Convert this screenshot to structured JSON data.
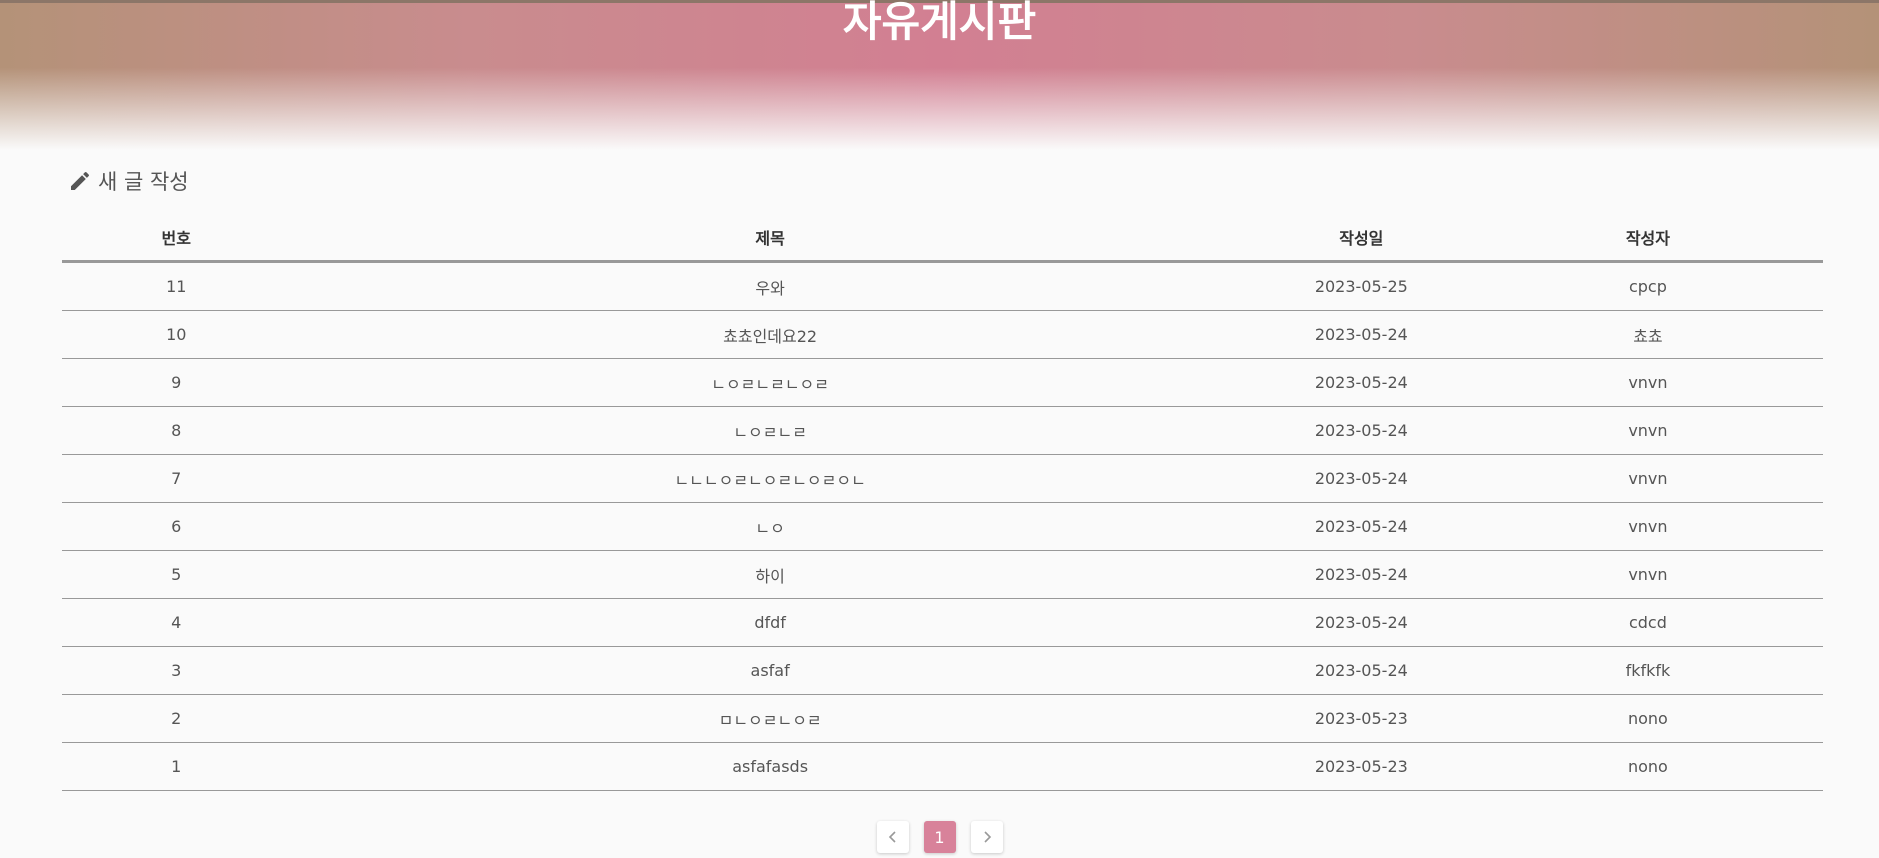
{
  "header": {
    "title": "자유게시판"
  },
  "toolbar": {
    "write_label": "새 글 작성"
  },
  "table": {
    "columns": [
      "번호",
      "제목",
      "작성일",
      "작성자"
    ],
    "rows": [
      {
        "no": "11",
        "title": "우와",
        "date": "2023-05-25",
        "author": "cpcp"
      },
      {
        "no": "10",
        "title": "쵸쵸인데요22",
        "date": "2023-05-24",
        "author": "쵸쵸"
      },
      {
        "no": "9",
        "title": "ㄴㅇㄹㄴㄹㄴㅇㄹ",
        "date": "2023-05-24",
        "author": "vnvn"
      },
      {
        "no": "8",
        "title": "ㄴㅇㄹㄴㄹ",
        "date": "2023-05-24",
        "author": "vnvn"
      },
      {
        "no": "7",
        "title": "ㄴㄴㄴㅇㄹㄴㅇㄹㄴㅇㄹㅇㄴ",
        "date": "2023-05-24",
        "author": "vnvn"
      },
      {
        "no": "6",
        "title": "ㄴㅇ",
        "date": "2023-05-24",
        "author": "vnvn"
      },
      {
        "no": "5",
        "title": "하이",
        "date": "2023-05-24",
        "author": "vnvn"
      },
      {
        "no": "4",
        "title": "dfdf",
        "date": "2023-05-24",
        "author": "cdcd"
      },
      {
        "no": "3",
        "title": "asfaf",
        "date": "2023-05-24",
        "author": "fkfkfk"
      },
      {
        "no": "2",
        "title": "ㅁㄴㅇㄹㄴㅇㄹ",
        "date": "2023-05-23",
        "author": "nono"
      },
      {
        "no": "1",
        "title": "asfafasds",
        "date": "2023-05-23",
        "author": "nono"
      }
    ]
  },
  "pagination": {
    "prev_icon": "chevron-left-icon",
    "next_icon": "chevron-right-icon",
    "pages": [
      "1"
    ],
    "current": "1",
    "active_color": "#d8829a"
  },
  "colors": {
    "background": "#fafafa",
    "banner_pink": "#d27f92",
    "banner_tan": "#b49278"
  }
}
